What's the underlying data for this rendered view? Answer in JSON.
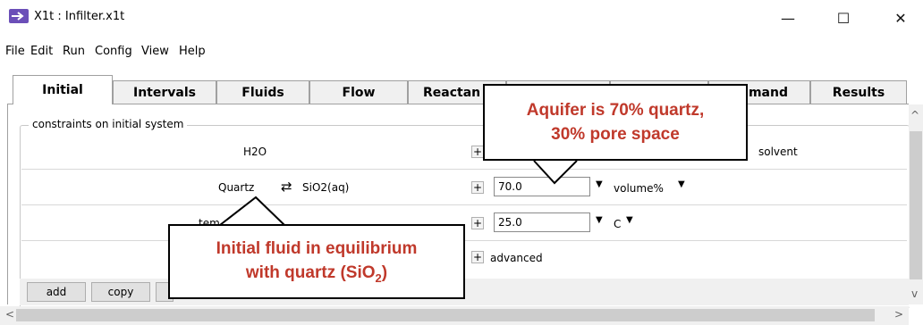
{
  "window": {
    "title": "X1t : Infilter.x1t",
    "minimize_glyph": "—",
    "maximize_glyph": "☐",
    "close_glyph": "✕"
  },
  "menu": [
    {
      "label": "File"
    },
    {
      "label": "Edit"
    },
    {
      "label": "Run"
    },
    {
      "label": "Config"
    },
    {
      "label": "View"
    },
    {
      "label": "Help"
    }
  ],
  "tabs": [
    {
      "label": "Initial",
      "active": true
    },
    {
      "label": "Intervals"
    },
    {
      "label": "Fluids"
    },
    {
      "label": "Flow"
    },
    {
      "label": "Reactan"
    },
    {
      "label": "mand"
    },
    {
      "label": "Results"
    }
  ],
  "group_label": "constraints on initial system",
  "rows": [
    {
      "label": "H2O",
      "unit": "solvent"
    },
    {
      "label": "Quartz",
      "swap_label": "SiO2(aq)",
      "value": "70.0",
      "unit": "volume%"
    },
    {
      "label": "tem",
      "value": "25.0",
      "unit": "C"
    },
    {
      "label": "advanced"
    }
  ],
  "buttons": [
    {
      "label": "add"
    },
    {
      "label": "copy"
    }
  ],
  "callouts": {
    "aquifer_line1": "Aquifer is 70% quartz,",
    "aquifer_line2": "30% pore space",
    "fluid_line1": "Initial fluid in equilibrium",
    "fluid_line2_prefix": "with quartz (SiO",
    "fluid_line2_sub": "2",
    "fluid_line2_suffix": ")"
  },
  "colors": {
    "callout_text": "#c0392b",
    "app_icon": "#6b4fb8"
  },
  "icons": [
    "app-icon",
    "swap-arrows-icon",
    "plus-icon",
    "dropdown-caret-icon",
    "scroll-up-icon",
    "scroll-down-icon",
    "scroll-left-icon",
    "scroll-right-icon"
  ]
}
